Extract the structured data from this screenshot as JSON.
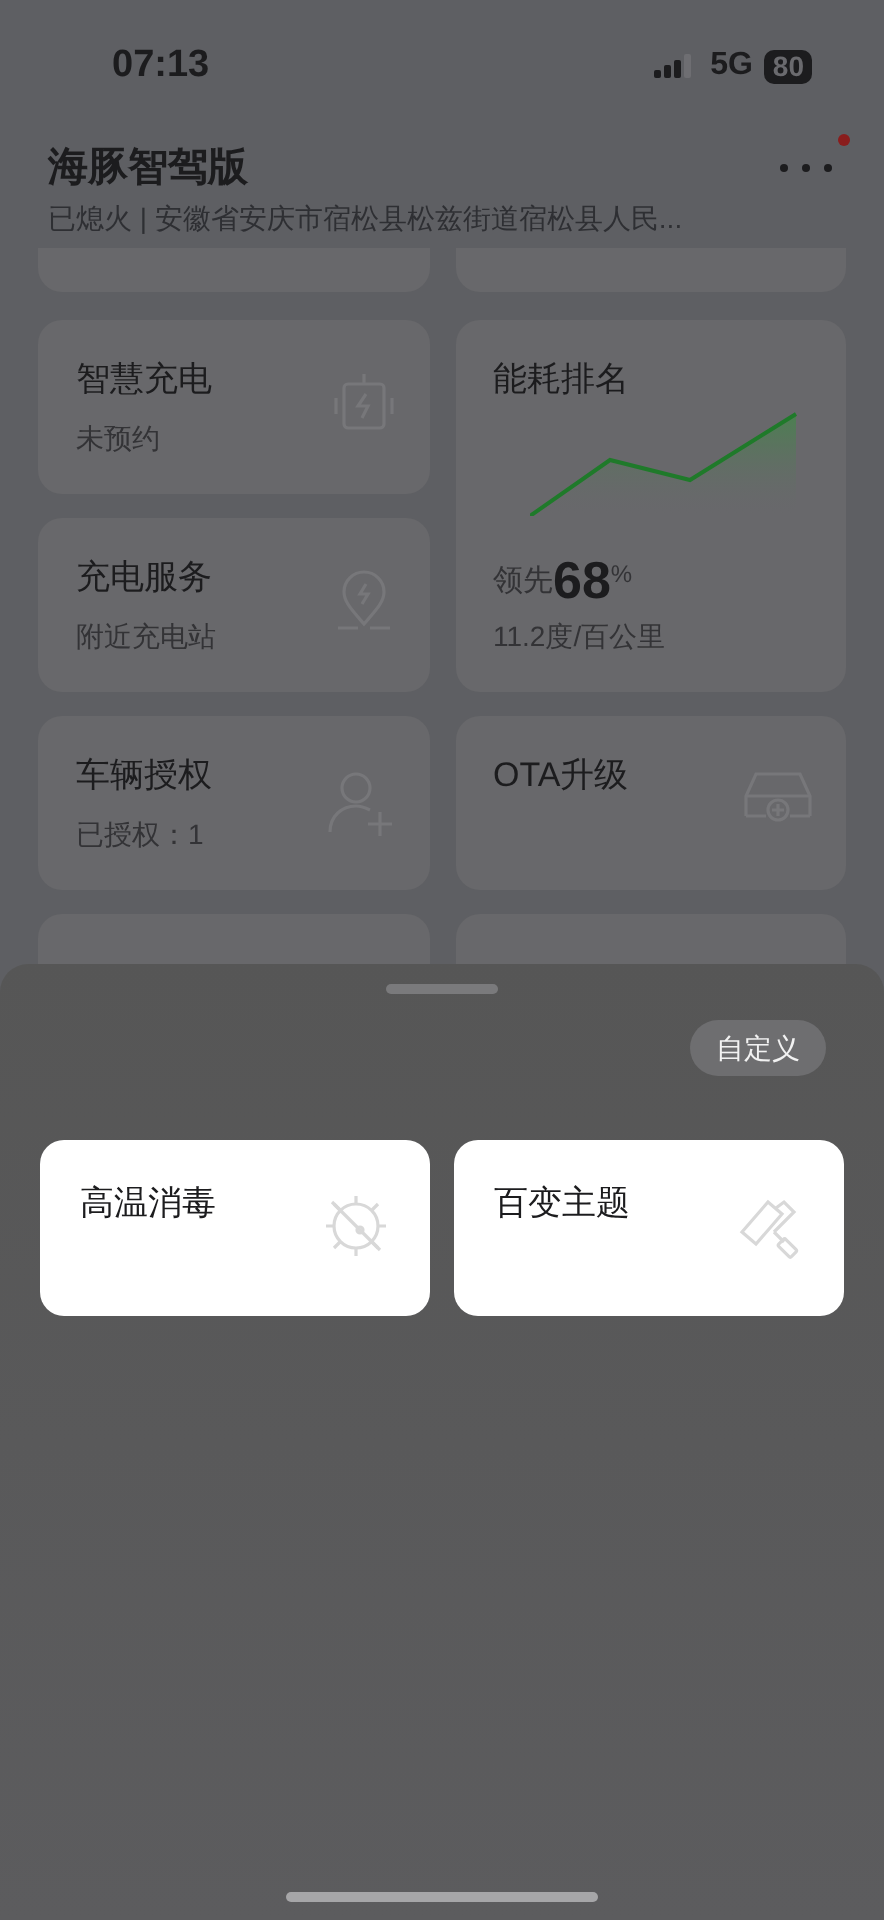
{
  "status_bar": {
    "time": "07:13",
    "network": "5G",
    "battery": "80"
  },
  "header": {
    "title": "海豚智驾版",
    "subtitle": "已熄火 | 安徽省安庆市宿松县松兹街道宿松县人民...",
    "notification": true
  },
  "left_cards": [
    {
      "kind": "status",
      "title": "智慧充电",
      "subtitle": "未预约"
    },
    {
      "kind": "status",
      "title": "充电服务",
      "subtitle": "附近充电站"
    },
    {
      "kind": "status",
      "title": "车辆授权",
      "subtitle": "已授权：1"
    }
  ],
  "right_cards": [
    {
      "kind": "ranking",
      "title": "能耗排名",
      "lead_label": "领先",
      "value": "68",
      "unit": "%",
      "consumption": "11.2度/百公里"
    },
    {
      "kind": "status",
      "title": "OTA升级"
    }
  ],
  "sheet": {
    "button": "自定义",
    "tiles": [
      {
        "title": "高温消毒"
      },
      {
        "title": "百变主题"
      }
    ]
  }
}
